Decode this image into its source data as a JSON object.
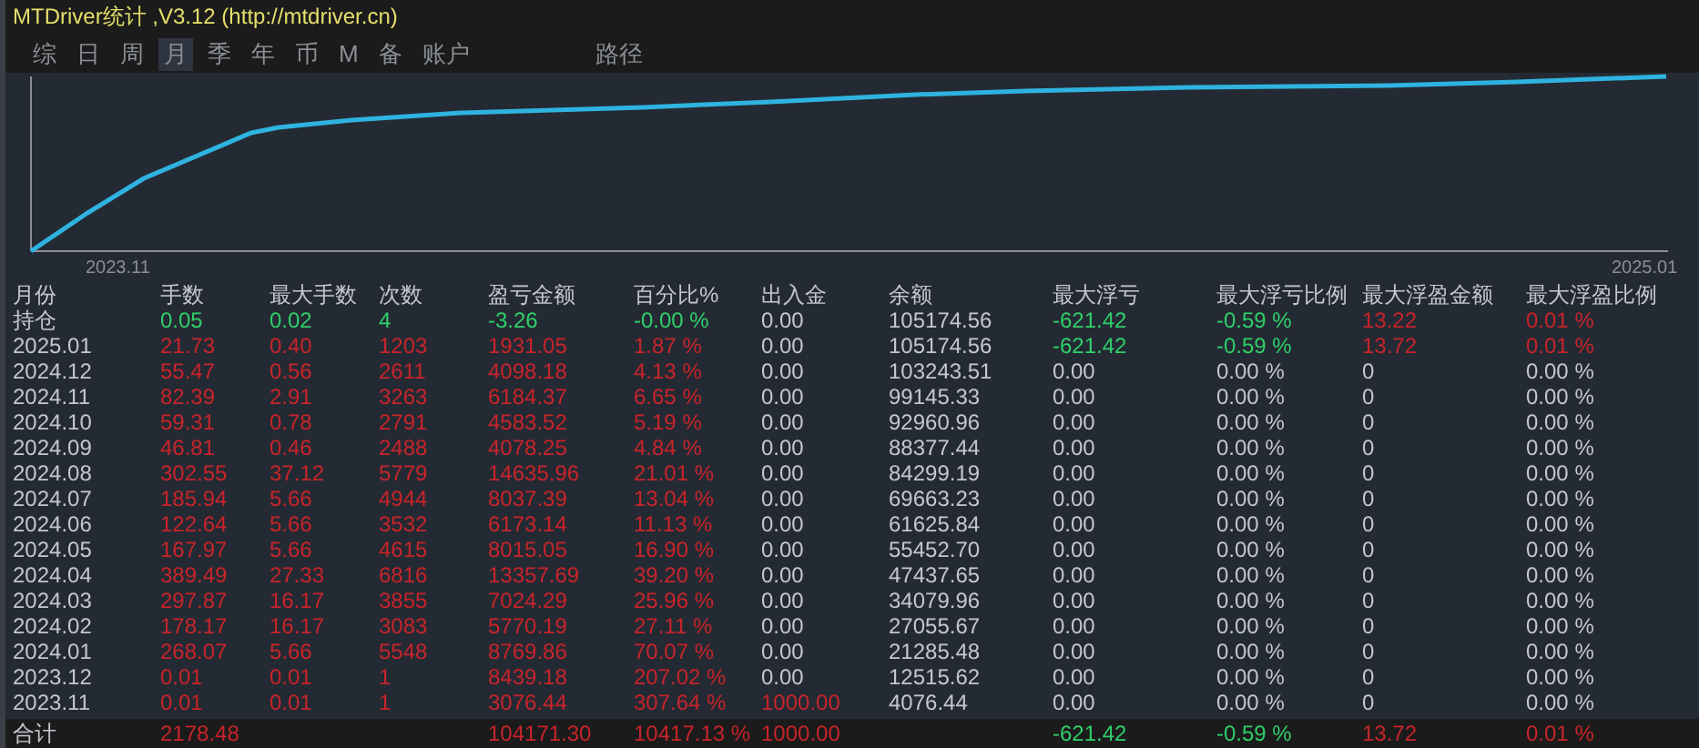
{
  "window": {
    "title": "MTDriver统计 ,V3.12 (http://mtdriver.cn)"
  },
  "tabs": [
    {
      "label": "综",
      "selected": false
    },
    {
      "label": "日",
      "selected": false
    },
    {
      "label": "周",
      "selected": false
    },
    {
      "label": "月",
      "selected": true
    },
    {
      "label": "季",
      "selected": false
    },
    {
      "label": "年",
      "selected": false
    },
    {
      "label": "币",
      "selected": false
    },
    {
      "label": "M",
      "selected": false
    },
    {
      "label": "备",
      "selected": false
    },
    {
      "label": "账户",
      "selected": false
    },
    {
      "label": "路径",
      "selected": false
    }
  ],
  "chart": {
    "x_start_label": "2023.11",
    "x_end_label": "2025.01"
  },
  "table": {
    "columns": [
      "月份",
      "手数",
      "最大手数",
      "次数",
      "盈亏金额",
      "百分比%",
      "出入金",
      "余额",
      "最大浮亏",
      "最大浮亏比例",
      "最大浮盈金额",
      "最大浮盈比例"
    ],
    "rows": [
      {
        "cells": [
          {
            "text": "持仓",
            "color": "#c3c8ce"
          },
          {
            "text": "0.05",
            "color": "#2fd06a"
          },
          {
            "text": "0.02",
            "color": "#2fd06a"
          },
          {
            "text": "4",
            "color": "#2fd06a"
          },
          {
            "text": "-3.26",
            "color": "#2fd06a"
          },
          {
            "text": "-0.00 %",
            "color": "#2fd06a"
          },
          {
            "text": "0.00",
            "color": "#c3c8ce"
          },
          {
            "text": "105174.56",
            "color": "#c3c8ce"
          },
          {
            "text": "-621.42",
            "color": "#2fd06a"
          },
          {
            "text": "-0.59 %",
            "color": "#2fd06a"
          },
          {
            "text": "13.22",
            "color": "#c8242b"
          },
          {
            "text": "0.01 %",
            "color": "#c8242b"
          }
        ]
      },
      {
        "cells": [
          {
            "text": "2025.01",
            "color": "#c3c8ce"
          },
          {
            "text": "21.73",
            "color": "#c8242b"
          },
          {
            "text": "0.40",
            "color": "#c8242b"
          },
          {
            "text": "1203",
            "color": "#c8242b"
          },
          {
            "text": "1931.05",
            "color": "#c8242b"
          },
          {
            "text": "1.87 %",
            "color": "#c8242b"
          },
          {
            "text": "0.00",
            "color": "#c3c8ce"
          },
          {
            "text": "105174.56",
            "color": "#c3c8ce"
          },
          {
            "text": "-621.42",
            "color": "#2fd06a"
          },
          {
            "text": "-0.59 %",
            "color": "#2fd06a"
          },
          {
            "text": "13.72",
            "color": "#c8242b"
          },
          {
            "text": "0.01 %",
            "color": "#c8242b"
          }
        ]
      },
      {
        "cells": [
          {
            "text": "2024.12",
            "color": "#c3c8ce"
          },
          {
            "text": "55.47",
            "color": "#c8242b"
          },
          {
            "text": "0.56",
            "color": "#c8242b"
          },
          {
            "text": "2611",
            "color": "#c8242b"
          },
          {
            "text": "4098.18",
            "color": "#c8242b"
          },
          {
            "text": "4.13 %",
            "color": "#c8242b"
          },
          {
            "text": "0.00",
            "color": "#c3c8ce"
          },
          {
            "text": "103243.51",
            "color": "#c3c8ce"
          },
          {
            "text": "0.00",
            "color": "#c3c8ce"
          },
          {
            "text": "0.00 %",
            "color": "#c3c8ce"
          },
          {
            "text": "0",
            "color": "#c3c8ce"
          },
          {
            "text": "0.00 %",
            "color": "#c3c8ce"
          }
        ]
      },
      {
        "cells": [
          {
            "text": "2024.11",
            "color": "#c3c8ce"
          },
          {
            "text": "82.39",
            "color": "#c8242b"
          },
          {
            "text": "2.91",
            "color": "#c8242b"
          },
          {
            "text": "3263",
            "color": "#c8242b"
          },
          {
            "text": "6184.37",
            "color": "#c8242b"
          },
          {
            "text": "6.65 %",
            "color": "#c8242b"
          },
          {
            "text": "0.00",
            "color": "#c3c8ce"
          },
          {
            "text": "99145.33",
            "color": "#c3c8ce"
          },
          {
            "text": "0.00",
            "color": "#c3c8ce"
          },
          {
            "text": "0.00 %",
            "color": "#c3c8ce"
          },
          {
            "text": "0",
            "color": "#c3c8ce"
          },
          {
            "text": "0.00 %",
            "color": "#c3c8ce"
          }
        ]
      },
      {
        "cells": [
          {
            "text": "2024.10",
            "color": "#c3c8ce"
          },
          {
            "text": "59.31",
            "color": "#c8242b"
          },
          {
            "text": "0.78",
            "color": "#c8242b"
          },
          {
            "text": "2791",
            "color": "#c8242b"
          },
          {
            "text": "4583.52",
            "color": "#c8242b"
          },
          {
            "text": "5.19 %",
            "color": "#c8242b"
          },
          {
            "text": "0.00",
            "color": "#c3c8ce"
          },
          {
            "text": "92960.96",
            "color": "#c3c8ce"
          },
          {
            "text": "0.00",
            "color": "#c3c8ce"
          },
          {
            "text": "0.00 %",
            "color": "#c3c8ce"
          },
          {
            "text": "0",
            "color": "#c3c8ce"
          },
          {
            "text": "0.00 %",
            "color": "#c3c8ce"
          }
        ]
      },
      {
        "cells": [
          {
            "text": "2024.09",
            "color": "#c3c8ce"
          },
          {
            "text": "46.81",
            "color": "#c8242b"
          },
          {
            "text": "0.46",
            "color": "#c8242b"
          },
          {
            "text": "2488",
            "color": "#c8242b"
          },
          {
            "text": "4078.25",
            "color": "#c8242b"
          },
          {
            "text": "4.84 %",
            "color": "#c8242b"
          },
          {
            "text": "0.00",
            "color": "#c3c8ce"
          },
          {
            "text": "88377.44",
            "color": "#c3c8ce"
          },
          {
            "text": "0.00",
            "color": "#c3c8ce"
          },
          {
            "text": "0.00 %",
            "color": "#c3c8ce"
          },
          {
            "text": "0",
            "color": "#c3c8ce"
          },
          {
            "text": "0.00 %",
            "color": "#c3c8ce"
          }
        ]
      },
      {
        "cells": [
          {
            "text": "2024.08",
            "color": "#c3c8ce"
          },
          {
            "text": "302.55",
            "color": "#c8242b"
          },
          {
            "text": "37.12",
            "color": "#c8242b"
          },
          {
            "text": "5779",
            "color": "#c8242b"
          },
          {
            "text": "14635.96",
            "color": "#c8242b"
          },
          {
            "text": "21.01 %",
            "color": "#c8242b"
          },
          {
            "text": "0.00",
            "color": "#c3c8ce"
          },
          {
            "text": "84299.19",
            "color": "#c3c8ce"
          },
          {
            "text": "0.00",
            "color": "#c3c8ce"
          },
          {
            "text": "0.00 %",
            "color": "#c3c8ce"
          },
          {
            "text": "0",
            "color": "#c3c8ce"
          },
          {
            "text": "0.00 %",
            "color": "#c3c8ce"
          }
        ]
      },
      {
        "cells": [
          {
            "text": "2024.07",
            "color": "#c3c8ce"
          },
          {
            "text": "185.94",
            "color": "#c8242b"
          },
          {
            "text": "5.66",
            "color": "#c8242b"
          },
          {
            "text": "4944",
            "color": "#c8242b"
          },
          {
            "text": "8037.39",
            "color": "#c8242b"
          },
          {
            "text": "13.04 %",
            "color": "#c8242b"
          },
          {
            "text": "0.00",
            "color": "#c3c8ce"
          },
          {
            "text": "69663.23",
            "color": "#c3c8ce"
          },
          {
            "text": "0.00",
            "color": "#c3c8ce"
          },
          {
            "text": "0.00 %",
            "color": "#c3c8ce"
          },
          {
            "text": "0",
            "color": "#c3c8ce"
          },
          {
            "text": "0.00 %",
            "color": "#c3c8ce"
          }
        ]
      },
      {
        "cells": [
          {
            "text": "2024.06",
            "color": "#c3c8ce"
          },
          {
            "text": "122.64",
            "color": "#c8242b"
          },
          {
            "text": "5.66",
            "color": "#c8242b"
          },
          {
            "text": "3532",
            "color": "#c8242b"
          },
          {
            "text": "6173.14",
            "color": "#c8242b"
          },
          {
            "text": "11.13 %",
            "color": "#c8242b"
          },
          {
            "text": "0.00",
            "color": "#c3c8ce"
          },
          {
            "text": "61625.84",
            "color": "#c3c8ce"
          },
          {
            "text": "0.00",
            "color": "#c3c8ce"
          },
          {
            "text": "0.00 %",
            "color": "#c3c8ce"
          },
          {
            "text": "0",
            "color": "#c3c8ce"
          },
          {
            "text": "0.00 %",
            "color": "#c3c8ce"
          }
        ]
      },
      {
        "cells": [
          {
            "text": "2024.05",
            "color": "#c3c8ce"
          },
          {
            "text": "167.97",
            "color": "#c8242b"
          },
          {
            "text": "5.66",
            "color": "#c8242b"
          },
          {
            "text": "4615",
            "color": "#c8242b"
          },
          {
            "text": "8015.05",
            "color": "#c8242b"
          },
          {
            "text": "16.90 %",
            "color": "#c8242b"
          },
          {
            "text": "0.00",
            "color": "#c3c8ce"
          },
          {
            "text": "55452.70",
            "color": "#c3c8ce"
          },
          {
            "text": "0.00",
            "color": "#c3c8ce"
          },
          {
            "text": "0.00 %",
            "color": "#c3c8ce"
          },
          {
            "text": "0",
            "color": "#c3c8ce"
          },
          {
            "text": "0.00 %",
            "color": "#c3c8ce"
          }
        ]
      },
      {
        "cells": [
          {
            "text": "2024.04",
            "color": "#c3c8ce"
          },
          {
            "text": "389.49",
            "color": "#c8242b"
          },
          {
            "text": "27.33",
            "color": "#c8242b"
          },
          {
            "text": "6816",
            "color": "#c8242b"
          },
          {
            "text": "13357.69",
            "color": "#c8242b"
          },
          {
            "text": "39.20 %",
            "color": "#c8242b"
          },
          {
            "text": "0.00",
            "color": "#c3c8ce"
          },
          {
            "text": "47437.65",
            "color": "#c3c8ce"
          },
          {
            "text": "0.00",
            "color": "#c3c8ce"
          },
          {
            "text": "0.00 %",
            "color": "#c3c8ce"
          },
          {
            "text": "0",
            "color": "#c3c8ce"
          },
          {
            "text": "0.00 %",
            "color": "#c3c8ce"
          }
        ]
      },
      {
        "cells": [
          {
            "text": "2024.03",
            "color": "#c3c8ce"
          },
          {
            "text": "297.87",
            "color": "#c8242b"
          },
          {
            "text": "16.17",
            "color": "#c8242b"
          },
          {
            "text": "3855",
            "color": "#c8242b"
          },
          {
            "text": "7024.29",
            "color": "#c8242b"
          },
          {
            "text": "25.96 %",
            "color": "#c8242b"
          },
          {
            "text": "0.00",
            "color": "#c3c8ce"
          },
          {
            "text": "34079.96",
            "color": "#c3c8ce"
          },
          {
            "text": "0.00",
            "color": "#c3c8ce"
          },
          {
            "text": "0.00 %",
            "color": "#c3c8ce"
          },
          {
            "text": "0",
            "color": "#c3c8ce"
          },
          {
            "text": "0.00 %",
            "color": "#c3c8ce"
          }
        ]
      },
      {
        "cells": [
          {
            "text": "2024.02",
            "color": "#c3c8ce"
          },
          {
            "text": "178.17",
            "color": "#c8242b"
          },
          {
            "text": "16.17",
            "color": "#c8242b"
          },
          {
            "text": "3083",
            "color": "#c8242b"
          },
          {
            "text": "5770.19",
            "color": "#c8242b"
          },
          {
            "text": "27.11 %",
            "color": "#c8242b"
          },
          {
            "text": "0.00",
            "color": "#c3c8ce"
          },
          {
            "text": "27055.67",
            "color": "#c3c8ce"
          },
          {
            "text": "0.00",
            "color": "#c3c8ce"
          },
          {
            "text": "0.00 %",
            "color": "#c3c8ce"
          },
          {
            "text": "0",
            "color": "#c3c8ce"
          },
          {
            "text": "0.00 %",
            "color": "#c3c8ce"
          }
        ]
      },
      {
        "cells": [
          {
            "text": "2024.01",
            "color": "#c3c8ce"
          },
          {
            "text": "268.07",
            "color": "#c8242b"
          },
          {
            "text": "5.66",
            "color": "#c8242b"
          },
          {
            "text": "5548",
            "color": "#c8242b"
          },
          {
            "text": "8769.86",
            "color": "#c8242b"
          },
          {
            "text": "70.07 %",
            "color": "#c8242b"
          },
          {
            "text": "0.00",
            "color": "#c3c8ce"
          },
          {
            "text": "21285.48",
            "color": "#c3c8ce"
          },
          {
            "text": "0.00",
            "color": "#c3c8ce"
          },
          {
            "text": "0.00 %",
            "color": "#c3c8ce"
          },
          {
            "text": "0",
            "color": "#c3c8ce"
          },
          {
            "text": "0.00 %",
            "color": "#c3c8ce"
          }
        ]
      },
      {
        "cells": [
          {
            "text": "2023.12",
            "color": "#c3c8ce"
          },
          {
            "text": "0.01",
            "color": "#c8242b"
          },
          {
            "text": "0.01",
            "color": "#c8242b"
          },
          {
            "text": "1",
            "color": "#c8242b"
          },
          {
            "text": "8439.18",
            "color": "#c8242b"
          },
          {
            "text": "207.02 %",
            "color": "#c8242b"
          },
          {
            "text": "0.00",
            "color": "#c3c8ce"
          },
          {
            "text": "12515.62",
            "color": "#c3c8ce"
          },
          {
            "text": "0.00",
            "color": "#c3c8ce"
          },
          {
            "text": "0.00 %",
            "color": "#c3c8ce"
          },
          {
            "text": "0",
            "color": "#c3c8ce"
          },
          {
            "text": "0.00 %",
            "color": "#c3c8ce"
          }
        ]
      },
      {
        "cells": [
          {
            "text": "2023.11",
            "color": "#c3c8ce"
          },
          {
            "text": "0.01",
            "color": "#c8242b"
          },
          {
            "text": "0.01",
            "color": "#c8242b"
          },
          {
            "text": "1",
            "color": "#c8242b"
          },
          {
            "text": "3076.44",
            "color": "#c8242b"
          },
          {
            "text": "307.64 %",
            "color": "#c8242b"
          },
          {
            "text": "1000.00",
            "color": "#c8242b"
          },
          {
            "text": "4076.44",
            "color": "#c3c8ce"
          },
          {
            "text": "0.00",
            "color": "#c3c8ce"
          },
          {
            "text": "0.00 %",
            "color": "#c3c8ce"
          },
          {
            "text": "0",
            "color": "#c3c8ce"
          },
          {
            "text": "0.00 %",
            "color": "#c3c8ce"
          }
        ]
      }
    ],
    "total": {
      "cells": [
        {
          "text": "合计",
          "color": "#c3c8ce"
        },
        {
          "text": "2178.48",
          "color": "#c8242b"
        },
        null,
        null,
        {
          "text": "104171.30",
          "color": "#c8242b"
        },
        {
          "text": "10417.13 %",
          "color": "#c8242b"
        },
        {
          "text": "1000.00",
          "color": "#c8242b"
        },
        null,
        {
          "text": "-621.42",
          "color": "#2fd06a"
        },
        {
          "text": "-0.59 %",
          "color": "#2fd06a"
        },
        {
          "text": "13.72",
          "color": "#c8242b"
        },
        {
          "text": "0.01 %",
          "color": "#c8242b"
        }
      ]
    }
  }
}
